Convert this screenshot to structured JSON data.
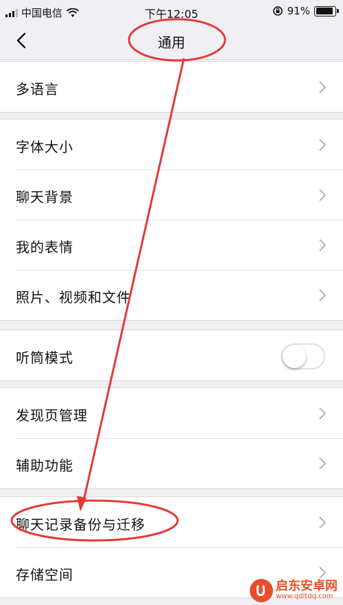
{
  "status_bar": {
    "carrier": "中国电信",
    "time": "下午12:05",
    "battery": "91%",
    "battery_level": 0.91
  },
  "nav": {
    "title": "通用"
  },
  "groups": [
    {
      "items": [
        {
          "label": "多语言"
        }
      ]
    },
    {
      "items": [
        {
          "label": "字体大小"
        },
        {
          "label": "聊天背景"
        },
        {
          "label": "我的表情"
        },
        {
          "label": "照片、视频和文件"
        }
      ]
    },
    {
      "items": [
        {
          "label": "听筒模式",
          "toggle": false
        }
      ]
    },
    {
      "items": [
        {
          "label": "发现页管理"
        },
        {
          "label": "辅助功能"
        }
      ]
    },
    {
      "items": [
        {
          "label": "聊天记录备份与迁移"
        },
        {
          "label": "存储空间"
        }
      ]
    }
  ],
  "annotation_color": "#e53935",
  "watermark": {
    "name": "启东安卓网",
    "url": "www.qdltdq.com"
  }
}
